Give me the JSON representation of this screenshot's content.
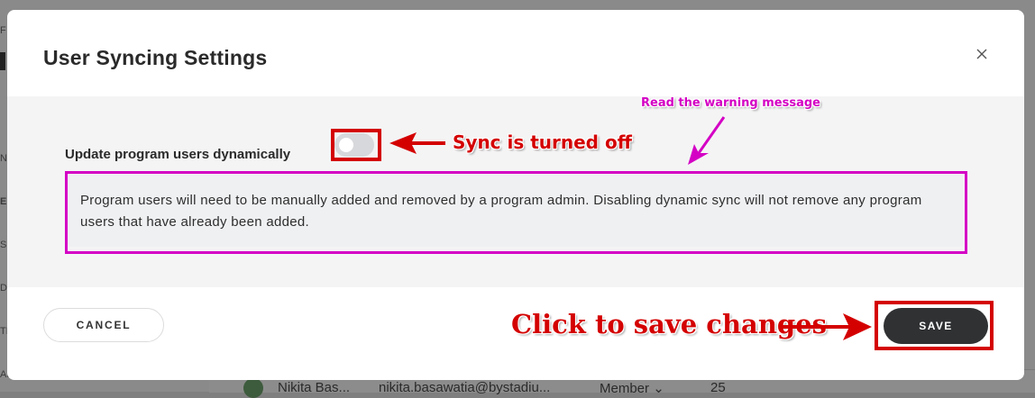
{
  "modal": {
    "title": "User Syncing Settings",
    "setting_label": "Update program users dynamically",
    "toggle_state": "off",
    "warning_text": "Program users will need to be manually added and removed by a program admin. Disabling dynamic sync will not remove any program users that have already been added.",
    "cancel_label": "CANCEL",
    "save_label": "SAVE",
    "close_icon": "close-icon"
  },
  "annotations": {
    "sync_off": "Sync is turned off",
    "read_warning": "Read the warning message",
    "click_save": "Click to save changes"
  },
  "background": {
    "row_name": "Nikita Bas...",
    "row_email": "nikita.basawatia@bystadiu...",
    "row_role": "Member",
    "row_count": "25",
    "sidebar_letters": [
      "F",
      "N",
      "E",
      "S",
      "D",
      "TE",
      "AL"
    ]
  },
  "colors": {
    "annotation_red": "#d40000",
    "annotation_magenta": "#d400c4",
    "save_button": "#2f3133"
  }
}
